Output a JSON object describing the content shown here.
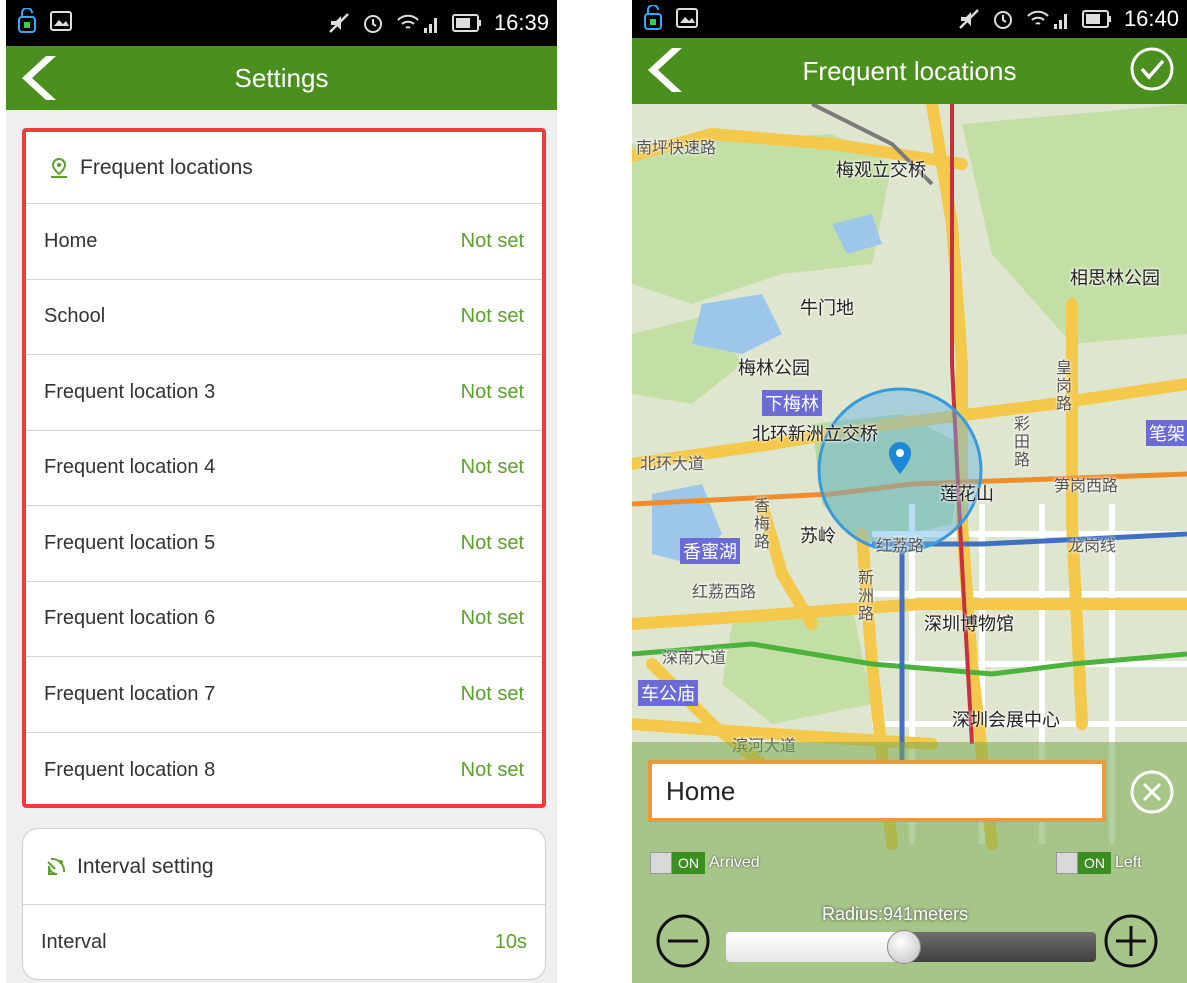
{
  "left_screen": {
    "status_bar": {
      "time": "16:39"
    },
    "app_bar": {
      "title": "Settings"
    },
    "frequent_locations": {
      "header": "Frequent locations",
      "items": [
        {
          "label": "Home",
          "value": "Not set"
        },
        {
          "label": "School",
          "value": "Not set"
        },
        {
          "label": "Frequent location 3",
          "value": "Not set"
        },
        {
          "label": "Frequent location 4",
          "value": "Not set"
        },
        {
          "label": "Frequent location 5",
          "value": "Not set"
        },
        {
          "label": "Frequent location 6",
          "value": "Not set"
        },
        {
          "label": "Frequent location 7",
          "value": "Not set"
        },
        {
          "label": "Frequent location 8",
          "value": "Not set"
        }
      ]
    },
    "interval_setting": {
      "header": "Interval setting",
      "items": [
        {
          "label": "Interval",
          "value": "10s"
        }
      ]
    }
  },
  "right_screen": {
    "status_bar": {
      "time": "16:40"
    },
    "app_bar": {
      "title": "Frequent locations"
    },
    "map_labels": {
      "road_nanping": "南坪快速路",
      "meiguan_bridge": "梅观立交桥",
      "xiangsilin_park": "相思林公园",
      "niuwandi": "牛门地",
      "meilin_park": "梅林公园",
      "xiameilin": "下梅林",
      "beihuan_xinzhou_bridge": "北环新洲立交桥",
      "beihuan_road": "北环大道",
      "caitian_road": "彩田路",
      "huanggang_road": "皇岗路",
      "bijia": "笔架",
      "lianhuashan": "莲花山",
      "xiangmei_road": "香梅路",
      "suling": "苏岭",
      "xiangmihu": "香蜜湖",
      "hongli_road": "红荔路",
      "hongli_west_road": "红荔西路",
      "xinzhou_road": "新洲路",
      "shenzhen_museum": "深圳博物馆",
      "shennan_road": "深南大道",
      "chegongmiao": "车公庙",
      "convention_center": "深圳会展中心",
      "longgang_line": "龙岗线",
      "sungang_west_road": "笋岗西路",
      "binhe_road": "滨河大道"
    },
    "geofence": {
      "name_value": "Home",
      "arrived": {
        "state": "ON",
        "label": "Arrived"
      },
      "left": {
        "state": "ON",
        "label": "Left"
      },
      "radius_label": "Radius:941meters",
      "radius_fraction": 0.48
    }
  },
  "colors": {
    "accent_green": "#4b8f1f",
    "value_green": "#5ea02c",
    "highlight_red": "#ef3b3b",
    "input_border_orange": "#e79a3f"
  },
  "icons": {
    "back": "chevron-left-icon",
    "confirm": "check-circle-icon",
    "location": "map-pin-icon",
    "interval": "satellite-icon",
    "clear": "close-circle-icon",
    "zoom_out": "minus-circle-icon",
    "zoom_in": "plus-circle-icon"
  }
}
